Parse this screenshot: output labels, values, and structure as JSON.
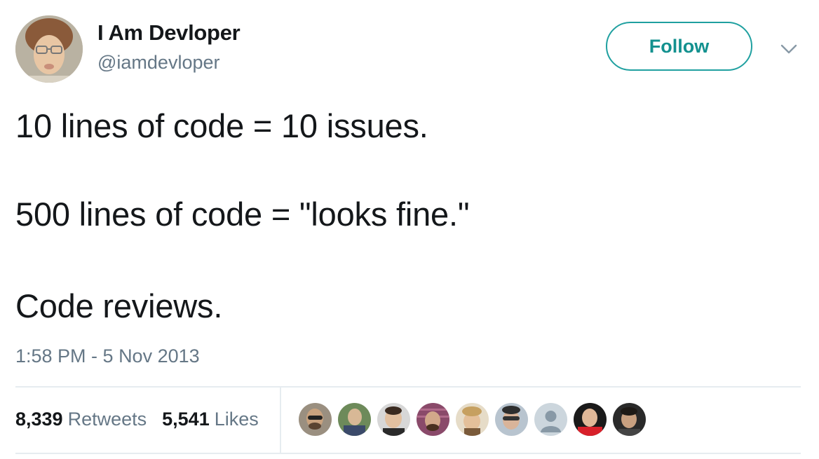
{
  "author": {
    "display_name": "I Am Devloper",
    "handle": "@iamdevloper"
  },
  "follow_label": "Follow",
  "tweet": {
    "lines": [
      "10 lines of code = 10 issues.",
      "500 lines of code = \"looks fine.\"",
      "Code reviews."
    ],
    "timestamp": "1:58 PM - 5 Nov 2013"
  },
  "stats": {
    "retweets_count": "8,339",
    "retweets_label": "Retweets",
    "likes_count": "5,541",
    "likes_label": "Likes"
  },
  "colors": {
    "accent": "#1fa0a0",
    "secondary_text": "#657786",
    "divider": "#e6ecf0"
  },
  "icons": [
    "chevron-down-icon",
    "default-avatar-icon"
  ]
}
